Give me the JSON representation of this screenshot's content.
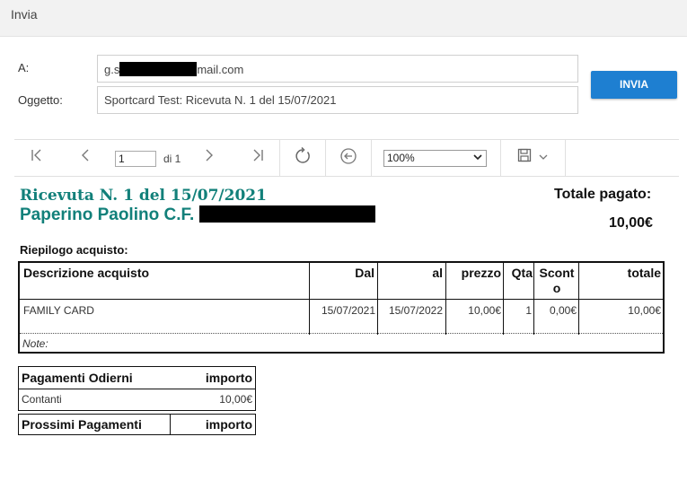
{
  "window": {
    "title": "Invia"
  },
  "form": {
    "to_label": "A:",
    "to_prefix": "g.s",
    "to_suffix": "mail.com",
    "subject_label": "Oggetto:",
    "subject_value": "Sportcard Test: Ricevuta N. 1 del 15/07/2021",
    "send_label": "INVIA"
  },
  "toolbar": {
    "page_value": "1",
    "page_of": "di 1",
    "zoom_value": "100%",
    "icons": [
      "first-page-icon",
      "prev-page-icon",
      "next-page-icon",
      "last-page-icon",
      "refresh-icon",
      "back-icon",
      "save-icon",
      "chevron-down-icon"
    ]
  },
  "receipt": {
    "title": "Ricevuta N. 1 del 15/07/2021",
    "customer": "Paperino Paolino C.F.",
    "total_label": "Totale pagato:",
    "total_value": "10,00€",
    "summary_label": "Riepilogo acquisto:",
    "columns": {
      "descr": "Descrizione acquisto",
      "dal": "Dal",
      "al": "al",
      "prezzo": "prezzo",
      "qta": "Qta",
      "sconto": "Scont o",
      "totale": "totale"
    },
    "row": {
      "descr": "FAMILY CARD",
      "dal": "15/07/2021",
      "al": "15/07/2022",
      "prezzo": "10,00€",
      "qta": "1",
      "sconto": "0,00€",
      "totale": "10,00€"
    },
    "note_label": "Note:",
    "payments_today": {
      "title": "Pagamenti Odierni",
      "amount_header": "importo",
      "method": "Contanti",
      "amount": "10,00€"
    },
    "next_payments": {
      "title": "Prossimi Pagamenti",
      "amount_header": "importo"
    }
  },
  "colors": {
    "accent": "#1e7fd1",
    "receipt_title": "#12807a"
  }
}
